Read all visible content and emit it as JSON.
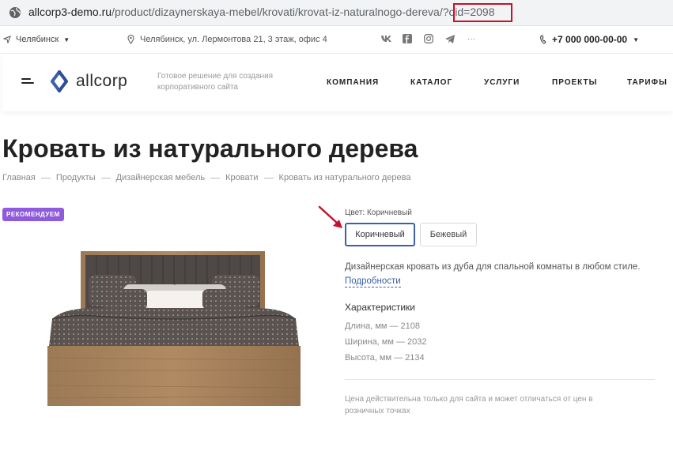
{
  "browser": {
    "url_host": "allcorp3-demo.ru",
    "url_path": "/product/dizaynerskaya-mebel/krovati/krovat-iz-naturalnogo-dereva/?oid=2098"
  },
  "topbar": {
    "city": "Челябинск",
    "address": "Челябинск, ул. Лермонтова 21, 3 этаж, офис 4",
    "socials": [
      "vk-icon",
      "facebook-icon",
      "instagram-icon",
      "telegram-icon"
    ],
    "more": "···",
    "phone": "+7 000 000-00-00"
  },
  "header": {
    "logo_text": "allcorp",
    "tagline": "Готовое решение для создания корпоративного сайта",
    "nav": [
      "КОМПАНИЯ",
      "КАТАЛОГ",
      "УСЛУГИ",
      "ПРОЕКТЫ",
      "ТАРИФЫ"
    ]
  },
  "page": {
    "title": "Кровать из натурального дерева",
    "breadcrumb": [
      "Главная",
      "Продукты",
      "Дизайнерская мебель",
      "Кровати",
      "Кровать из натурального дерева"
    ]
  },
  "product": {
    "badge": "РЕКОМЕНДУЕМ",
    "color_label": "Цвет: Коричневый",
    "colors": [
      "Коричневый",
      "Бежевый"
    ],
    "description": "Дизайнерская кровать из дуба для спальной комнаты в любом стиле.",
    "more_link": "Подробности",
    "specs_title": "Характеристики",
    "specs": [
      "Длина, мм — 2108",
      "Ширина, мм — 2032",
      "Высота, мм — 2134"
    ],
    "price_note": "Цена действительна только для сайта и может отличаться от цен в розничных точках"
  },
  "colors": {
    "badge": "#8e5bdc",
    "accent": "#3c5fa8",
    "highlight": "#c8102e"
  }
}
